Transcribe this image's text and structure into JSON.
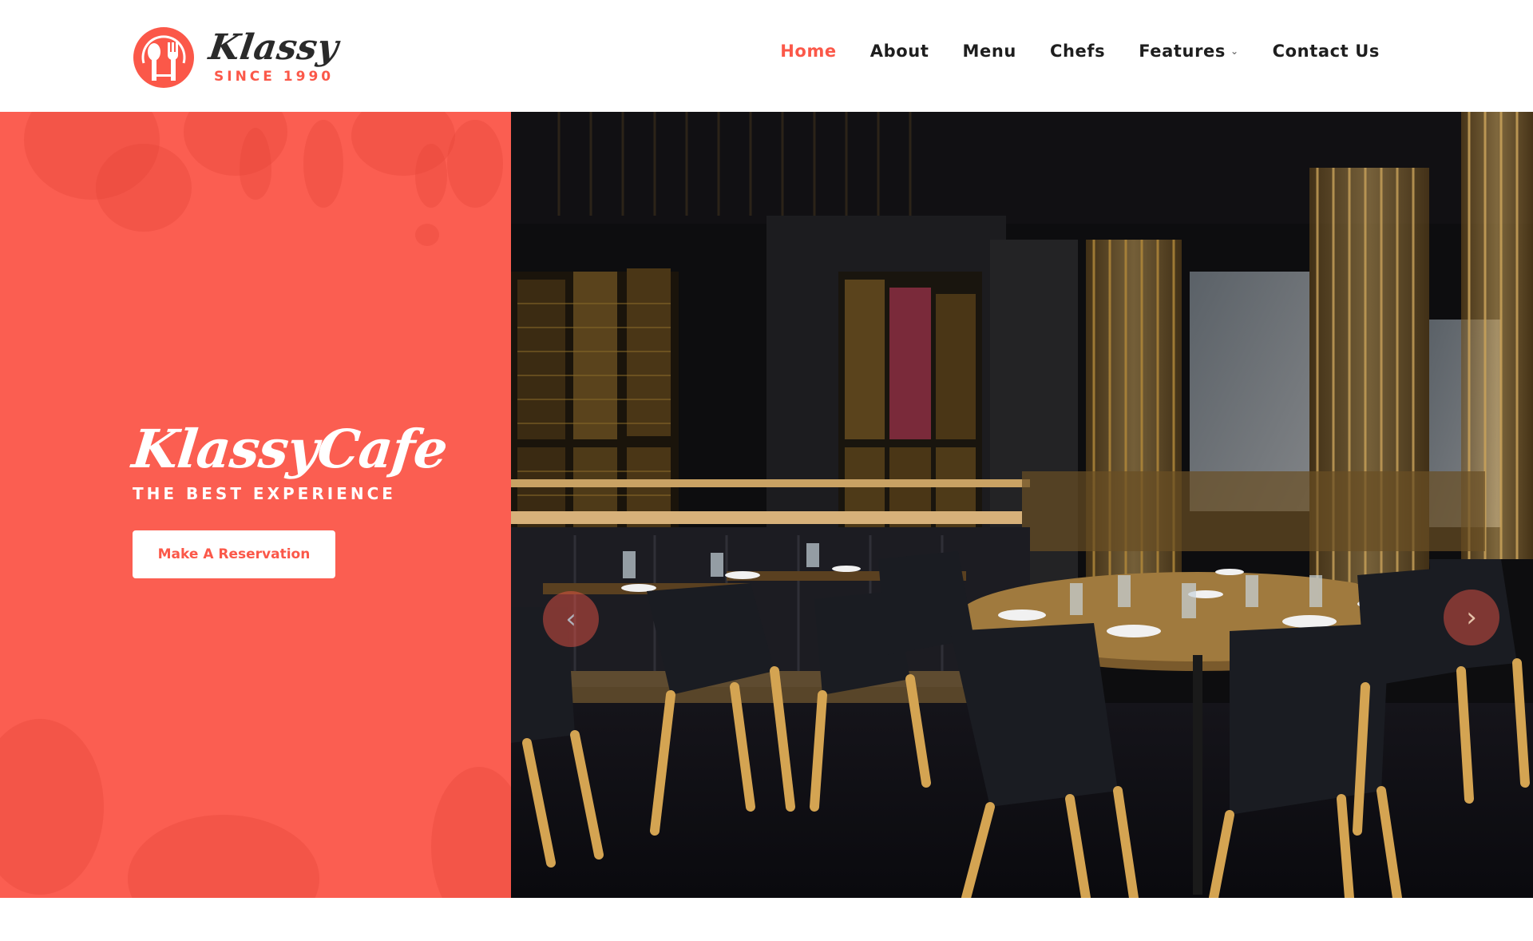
{
  "brand": {
    "name": "Klassy",
    "tagline": "SINCE 1990",
    "accent_color": "#fb5849"
  },
  "nav": {
    "items": [
      {
        "label": "Home",
        "active": true
      },
      {
        "label": "About",
        "active": false
      },
      {
        "label": "Menu",
        "active": false
      },
      {
        "label": "Chefs",
        "active": false
      },
      {
        "label": "Features",
        "active": false,
        "has_dropdown": true
      },
      {
        "label": "Contact Us",
        "active": false
      }
    ],
    "dropdown_icon": "chevron-down-icon"
  },
  "hero": {
    "title": "KlassyCafe",
    "subtitle": "THE BEST EXPERIENCE",
    "cta_label": "Make A Reservation",
    "panel_color": "#fb5e51",
    "image_description": "restaurant interior with tables and black chairs",
    "prev_icon": "‹",
    "next_icon": "›"
  }
}
